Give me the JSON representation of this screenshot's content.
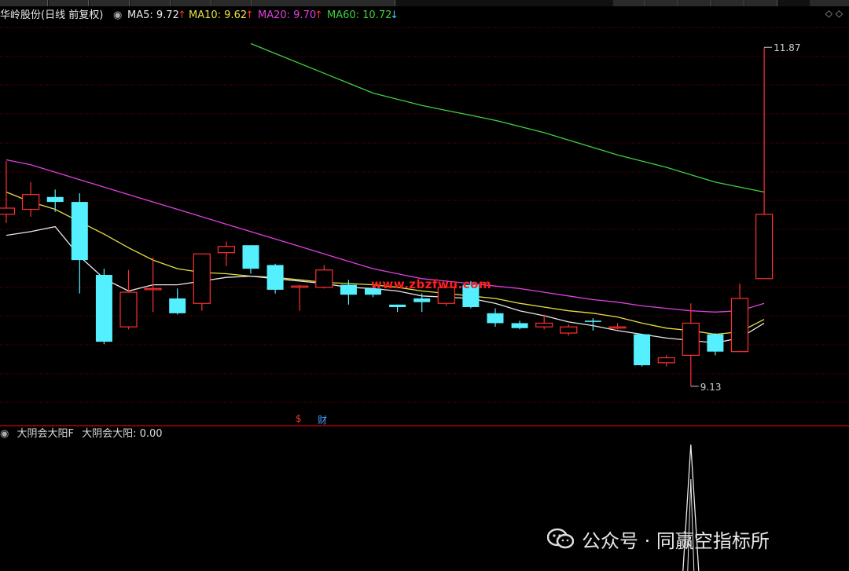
{
  "header": {
    "stock_name": "华岭股份(日线 前复权)",
    "ma5": "MA5: 9.72",
    "ma10": "MA10: 9.62",
    "ma20": "MA20: 9.70",
    "ma60": "MA60: 10.72",
    "arrow_up": "↑",
    "arrow_down": "↓",
    "corner_icons": "◇  ◇"
  },
  "colors": {
    "up": "#ff3030",
    "down": "#55f0ff",
    "ma5": "#e8e8e8",
    "ma10": "#e8e040",
    "ma20": "#e040e0",
    "ma60": "#40d040",
    "grid": "#7a0000"
  },
  "labels": {
    "high": "11.87",
    "low": "9.13",
    "watermark": "www.zbzfwu.com",
    "event_s": "$",
    "event_cai": "财"
  },
  "sub": {
    "name": "大阴会大阳F",
    "value_label": "大阴会大阳: 0.00"
  },
  "wechat": {
    "text": "公众号 · 同赢空指标所"
  },
  "chart_data": {
    "type": "candlestick",
    "ylim": [
      8.9,
      12.1
    ],
    "candles": [
      {
        "o": 10.52,
        "h": 10.95,
        "l": 10.45,
        "c": 10.57
      },
      {
        "o": 10.56,
        "h": 10.78,
        "l": 10.5,
        "c": 10.68
      },
      {
        "o": 10.66,
        "h": 10.72,
        "l": 10.54,
        "c": 10.62
      },
      {
        "o": 10.62,
        "h": 10.69,
        "l": 9.88,
        "c": 10.15
      },
      {
        "o": 10.03,
        "h": 10.08,
        "l": 9.47,
        "c": 9.49
      },
      {
        "o": 9.61,
        "h": 10.07,
        "l": 9.59,
        "c": 9.89
      },
      {
        "o": 9.92,
        "h": 10.17,
        "l": 9.73,
        "c": 9.92
      },
      {
        "o": 9.84,
        "h": 9.92,
        "l": 9.71,
        "c": 9.72
      },
      {
        "o": 9.8,
        "h": 10.18,
        "l": 9.74,
        "c": 10.2
      },
      {
        "o": 10.21,
        "h": 10.3,
        "l": 10.1,
        "c": 10.26
      },
      {
        "o": 10.27,
        "h": 10.27,
        "l": 10.04,
        "c": 10.08
      },
      {
        "o": 10.11,
        "h": 10.12,
        "l": 9.88,
        "c": 9.91
      },
      {
        "o": 9.93,
        "h": 9.95,
        "l": 9.74,
        "c": 9.94
      },
      {
        "o": 9.93,
        "h": 10.11,
        "l": 9.92,
        "c": 10.07
      },
      {
        "o": 9.95,
        "h": 9.99,
        "l": 9.79,
        "c": 9.87
      },
      {
        "o": 9.92,
        "h": 9.95,
        "l": 9.85,
        "c": 9.87
      },
      {
        "o": 9.79,
        "h": 9.79,
        "l": 9.73,
        "c": 9.77
      },
      {
        "o": 9.84,
        "h": 9.88,
        "l": 9.73,
        "c": 9.81
      },
      {
        "o": 9.8,
        "h": 9.94,
        "l": 9.78,
        "c": 9.93
      },
      {
        "o": 9.95,
        "h": 9.98,
        "l": 9.76,
        "c": 9.77
      },
      {
        "o": 9.72,
        "h": 9.76,
        "l": 9.61,
        "c": 9.64
      },
      {
        "o": 9.64,
        "h": 9.66,
        "l": 9.59,
        "c": 9.6
      },
      {
        "o": 9.61,
        "h": 9.71,
        "l": 9.59,
        "c": 9.64
      },
      {
        "o": 9.56,
        "h": 9.63,
        "l": 9.54,
        "c": 9.61
      },
      {
        "o": 9.66,
        "h": 9.68,
        "l": 9.58,
        "c": 9.65
      },
      {
        "o": 9.6,
        "h": 9.64,
        "l": 9.59,
        "c": 9.61
      },
      {
        "o": 9.55,
        "h": 9.55,
        "l": 9.29,
        "c": 9.3
      },
      {
        "o": 9.32,
        "h": 9.38,
        "l": 9.29,
        "c": 9.36
      },
      {
        "o": 9.38,
        "h": 9.8,
        "l": 9.13,
        "c": 9.64
      },
      {
        "o": 9.55,
        "h": 9.56,
        "l": 9.38,
        "c": 9.41
      },
      {
        "o": 9.41,
        "h": 9.96,
        "l": 9.41,
        "c": 9.84
      },
      {
        "o": 10.0,
        "h": 11.87,
        "l": 10.0,
        "c": 10.52
      }
    ],
    "ma5": [
      10.35,
      10.38,
      10.42,
      10.18,
      10.0,
      9.9,
      9.95,
      9.95,
      9.98,
      10.01,
      10.02,
      10.0,
      9.98,
      9.96,
      9.93,
      9.92,
      9.9,
      9.86,
      9.85,
      9.84,
      9.8,
      9.74,
      9.7,
      9.65,
      9.62,
      9.58,
      9.55,
      9.52,
      9.5,
      9.48,
      9.52,
      9.64
    ],
    "ma10": [
      10.7,
      10.62,
      10.56,
      10.46,
      10.36,
      10.25,
      10.15,
      10.08,
      10.05,
      10.04,
      10.02,
      10.01,
      9.99,
      9.97,
      9.96,
      9.95,
      9.93,
      9.9,
      9.88,
      9.86,
      9.84,
      9.8,
      9.77,
      9.74,
      9.72,
      9.69,
      9.64,
      9.6,
      9.58,
      9.55,
      9.57,
      9.67
    ],
    "ma20": [
      10.96,
      10.92,
      10.86,
      10.8,
      10.74,
      10.68,
      10.62,
      10.56,
      10.5,
      10.44,
      10.38,
      10.32,
      10.26,
      10.2,
      10.14,
      10.08,
      10.04,
      10.0,
      9.98,
      9.96,
      9.94,
      9.92,
      9.89,
      9.86,
      9.83,
      9.81,
      9.78,
      9.76,
      9.74,
      9.73,
      9.74,
      9.8
    ],
    "ma60": [
      null,
      null,
      null,
      null,
      null,
      null,
      null,
      null,
      null,
      null,
      11.9,
      11.82,
      11.74,
      11.66,
      11.58,
      11.5,
      11.45,
      11.4,
      11.36,
      11.32,
      11.28,
      11.23,
      11.18,
      11.12,
      11.06,
      11.0,
      10.95,
      10.9,
      10.84,
      10.78,
      10.74,
      10.7
    ],
    "sub_signal_index": 28
  }
}
